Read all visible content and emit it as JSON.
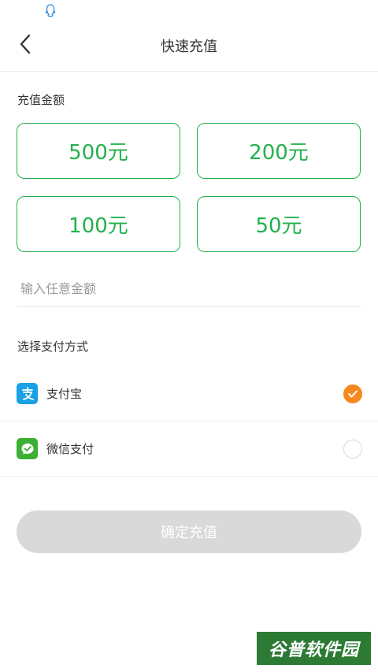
{
  "status_bar": {
    "icons": [
      "qq-icon"
    ]
  },
  "navbar": {
    "title": "快速充值",
    "back_icon": "chevron-left-icon"
  },
  "amount_section": {
    "label": "充值金额",
    "options": [
      {
        "label": "500元"
      },
      {
        "label": "200元"
      },
      {
        "label": "100元"
      },
      {
        "label": "50元"
      }
    ],
    "custom_input": {
      "placeholder": "输入任意金额",
      "value": ""
    }
  },
  "payment_section": {
    "label": "选择支付方式",
    "methods": [
      {
        "label": "支付宝",
        "icon": "alipay-icon",
        "icon_color": "#1aa0e5",
        "selected": true
      },
      {
        "label": "微信支付",
        "icon": "wechat-pay-icon",
        "icon_color": "#3cb034",
        "selected": false
      }
    ]
  },
  "confirm_button": {
    "label": "确定充值"
  },
  "watermark": {
    "text": "谷普软件园"
  },
  "colors": {
    "accent": "#22b14c",
    "selected": "#f5891f",
    "disabled_button": "#d9d9d9"
  }
}
